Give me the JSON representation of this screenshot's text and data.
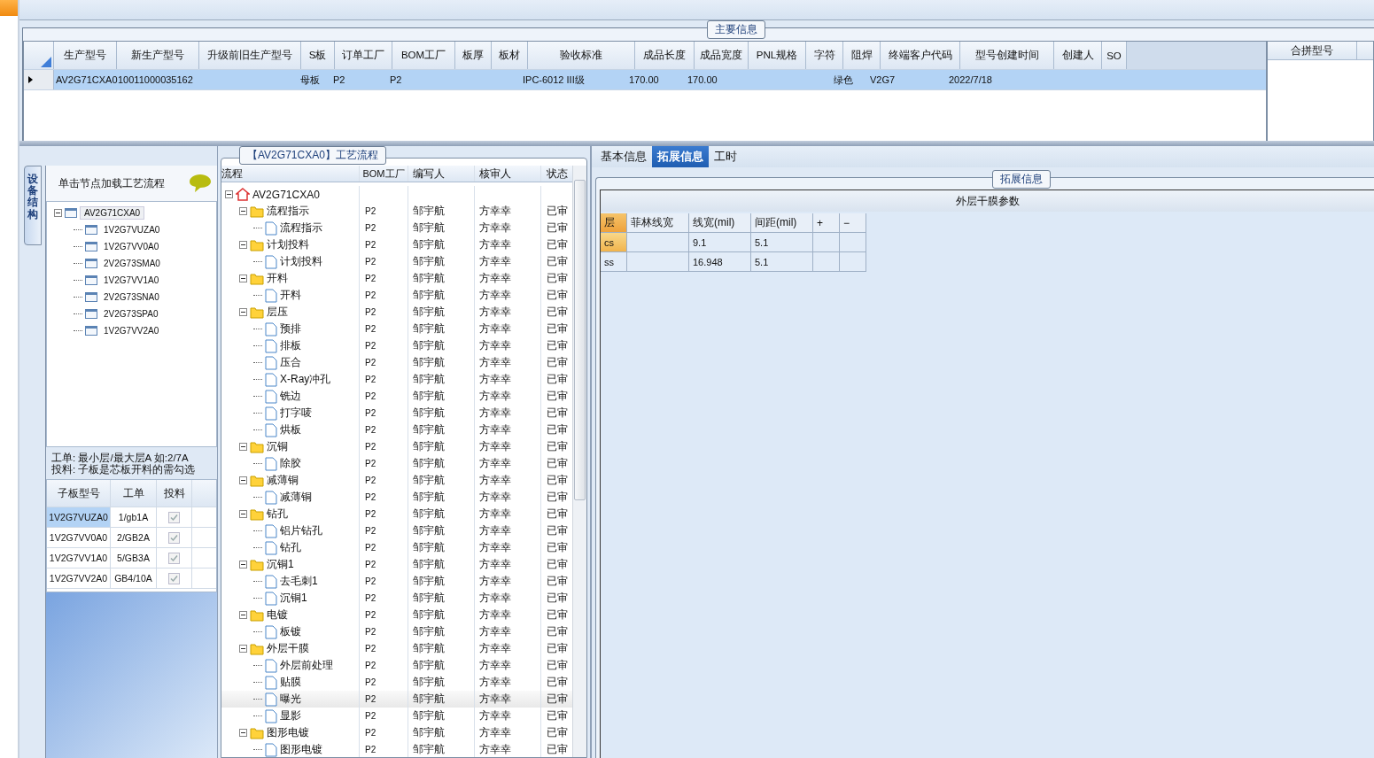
{
  "main_info": {
    "title": "主要信息",
    "grid": {
      "columns": [
        "生产型号",
        "新生产型号",
        "升级前旧生产型号",
        "S板",
        "订单工厂",
        "BOM工厂",
        "板厚",
        "板材",
        "验收标准",
        "成品长度",
        "成品宽度",
        "PNL规格",
        "字符",
        "阻焊",
        "终端客户代码",
        "型号创建时间",
        "创建人",
        "SO"
      ],
      "rows": [
        {
          "selected": true,
          "cells": [
            "AV2G71CXA0",
            "10011000035162",
            "",
            "母板",
            "P2",
            "P2",
            "",
            "",
            "IPC-6012 III级",
            "170.00",
            "170.00",
            "",
            "",
            "绿色",
            "V2G7",
            "2022/7/18",
            "",
            ""
          ]
        }
      ]
    },
    "merge_panel": {
      "heading": "合拼型号"
    }
  },
  "structure": {
    "side_tab": "设备结构",
    "header": "单击节点加载工艺流程",
    "tree": {
      "label": "AV2G71CXA0",
      "expanded": true,
      "selected": true,
      "children": [
        {
          "label": "1V2G7VUZA0",
          "selected": false
        },
        {
          "label": "1V2G7VV0A0",
          "selected": false
        },
        {
          "label": "2V2G73SMA0",
          "selected": false
        },
        {
          "label": "1V2G7VV1A0",
          "selected": false
        },
        {
          "label": "2V2G73SNA0",
          "selected": false
        },
        {
          "label": "2V2G73SPA0",
          "selected": false
        },
        {
          "label": "1V2G7VV2A0",
          "selected": false
        }
      ]
    },
    "notes": [
      "工单: 最小层/最大层A 如:2/7A",
      "投料: 子板是芯板开料的需勾选"
    ],
    "sub_table": {
      "columns": [
        "子板型号",
        "工单",
        "投料"
      ],
      "rows": [
        {
          "model": "1V2G7VUZA0",
          "order": "1/gb1A",
          "checked": true,
          "selected": true
        },
        {
          "model": "1V2G7VV0A0",
          "order": "2/GB2A",
          "checked": true,
          "selected": false
        },
        {
          "model": "1V2G7VV1A0",
          "order": "5/GB3A",
          "checked": true,
          "selected": false
        },
        {
          "model": "1V2G7VV2A0",
          "order": "GB4/10A",
          "checked": true,
          "selected": false
        }
      ]
    }
  },
  "process": {
    "title": "【AV2G71CXA0】工艺流程",
    "columns": [
      "流程",
      "BOM工厂",
      "编写人",
      "核审人",
      "状态"
    ],
    "root": {
      "label": "AV2G71CXA0",
      "expanded": true,
      "selected": false,
      "children": [
        {
          "label": "流程指示",
          "bom": "P2",
          "writer": "邹宇航",
          "reviewer": "方幸幸",
          "status": "已审",
          "expanded": true,
          "selected": false,
          "children": [
            {
              "label": "流程指示",
              "bom": "P2",
              "writer": "邹宇航",
              "reviewer": "方幸幸",
              "status": "已审",
              "selected": false
            }
          ]
        },
        {
          "label": "计划投料",
          "bom": "P2",
          "writer": "邹宇航",
          "reviewer": "方幸幸",
          "status": "已审",
          "expanded": true,
          "selected": false,
          "children": [
            {
              "label": "计划投料",
              "bom": "P2",
              "writer": "邹宇航",
              "reviewer": "方幸幸",
              "status": "已审",
              "selected": false
            }
          ]
        },
        {
          "label": "开料",
          "bom": "P2",
          "writer": "邹宇航",
          "reviewer": "方幸幸",
          "status": "已审",
          "expanded": true,
          "selected": false,
          "children": [
            {
              "label": "开料",
              "bom": "P2",
              "writer": "邹宇航",
              "reviewer": "方幸幸",
              "status": "已审",
              "selected": false
            }
          ]
        },
        {
          "label": "层压",
          "bom": "P2",
          "writer": "邹宇航",
          "reviewer": "方幸幸",
          "status": "已审",
          "expanded": true,
          "selected": false,
          "children": [
            {
              "label": "预排",
              "bom": "P2",
              "writer": "邹宇航",
              "reviewer": "方幸幸",
              "status": "已审",
              "selected": false
            },
            {
              "label": "排板",
              "bom": "P2",
              "writer": "邹宇航",
              "reviewer": "方幸幸",
              "status": "已审",
              "selected": false
            },
            {
              "label": "压合",
              "bom": "P2",
              "writer": "邹宇航",
              "reviewer": "方幸幸",
              "status": "已审",
              "selected": false
            },
            {
              "label": "X-Ray冲孔",
              "bom": "P2",
              "writer": "邹宇航",
              "reviewer": "方幸幸",
              "status": "已审",
              "selected": false
            },
            {
              "label": "铣边",
              "bom": "P2",
              "writer": "邹宇航",
              "reviewer": "方幸幸",
              "status": "已审",
              "selected": false
            },
            {
              "label": "打字唛",
              "bom": "P2",
              "writer": "邹宇航",
              "reviewer": "方幸幸",
              "status": "已审",
              "selected": false
            },
            {
              "label": "烘板",
              "bom": "P2",
              "writer": "邹宇航",
              "reviewer": "方幸幸",
              "status": "已审",
              "selected": false
            }
          ]
        },
        {
          "label": "沉铜",
          "bom": "P2",
          "writer": "邹宇航",
          "reviewer": "方幸幸",
          "status": "已审",
          "expanded": true,
          "selected": false,
          "children": [
            {
              "label": "除胶",
              "bom": "P2",
              "writer": "邹宇航",
              "reviewer": "方幸幸",
              "status": "已审",
              "selected": false
            }
          ]
        },
        {
          "label": "减薄铜",
          "bom": "P2",
          "writer": "邹宇航",
          "reviewer": "方幸幸",
          "status": "已审",
          "expanded": true,
          "selected": false,
          "children": [
            {
              "label": "减薄铜",
              "bom": "P2",
              "writer": "邹宇航",
              "reviewer": "方幸幸",
              "status": "已审",
              "selected": false
            }
          ]
        },
        {
          "label": "钻孔",
          "bom": "P2",
          "writer": "邹宇航",
          "reviewer": "方幸幸",
          "status": "已审",
          "expanded": true,
          "selected": false,
          "children": [
            {
              "label": "铝片钻孔",
              "bom": "P2",
              "writer": "邹宇航",
              "reviewer": "方幸幸",
              "status": "已审",
              "selected": false
            },
            {
              "label": "钻孔",
              "bom": "P2",
              "writer": "邹宇航",
              "reviewer": "方幸幸",
              "status": "已审",
              "selected": false
            }
          ]
        },
        {
          "label": "沉铜1",
          "bom": "P2",
          "writer": "邹宇航",
          "reviewer": "方幸幸",
          "status": "已审",
          "expanded": true,
          "selected": false,
          "children": [
            {
              "label": "去毛刺1",
              "bom": "P2",
              "writer": "邹宇航",
              "reviewer": "方幸幸",
              "status": "已审",
              "selected": false
            },
            {
              "label": "沉铜1",
              "bom": "P2",
              "writer": "邹宇航",
              "reviewer": "方幸幸",
              "status": "已审",
              "selected": false
            }
          ]
        },
        {
          "label": "电镀",
          "bom": "P2",
          "writer": "邹宇航",
          "reviewer": "方幸幸",
          "status": "已审",
          "expanded": true,
          "selected": false,
          "children": [
            {
              "label": "板镀",
              "bom": "P2",
              "writer": "邹宇航",
              "reviewer": "方幸幸",
              "status": "已审",
              "selected": false
            }
          ]
        },
        {
          "label": "外层干膜",
          "bom": "P2",
          "writer": "邹宇航",
          "reviewer": "方幸幸",
          "status": "已审",
          "expanded": true,
          "selected": false,
          "children": [
            {
              "label": "外层前处理",
              "bom": "P2",
              "writer": "邹宇航",
              "reviewer": "方幸幸",
              "status": "已审",
              "selected": false
            },
            {
              "label": "贴膜",
              "bom": "P2",
              "writer": "邹宇航",
              "reviewer": "方幸幸",
              "status": "已审",
              "selected": false
            },
            {
              "label": "曝光",
              "bom": "P2",
              "writer": "邹宇航",
              "reviewer": "方幸幸",
              "status": "已审",
              "selected": true
            },
            {
              "label": "显影",
              "bom": "P2",
              "writer": "邹宇航",
              "reviewer": "方幸幸",
              "status": "已审",
              "selected": false
            }
          ]
        },
        {
          "label": "图形电镀",
          "bom": "P2",
          "writer": "邹宇航",
          "reviewer": "方幸幸",
          "status": "已审",
          "expanded": true,
          "selected": false,
          "children": [
            {
              "label": "图形电镀",
              "bom": "P2",
              "writer": "邹宇航",
              "reviewer": "方幸幸",
              "status": "已审",
              "selected": false
            }
          ]
        }
      ]
    }
  },
  "details": {
    "tabs": [
      {
        "label": "基本信息",
        "selected": false
      },
      {
        "label": "拓展信息",
        "selected": true
      },
      {
        "label": "工时",
        "selected": false
      }
    ],
    "group_title": "拓展信息",
    "table_title": "外层干膜参数",
    "columns": [
      "层",
      "菲林线宽",
      "线宽(mil)",
      "间距(mil)",
      "+",
      "−"
    ],
    "rows": [
      {
        "selected": true,
        "cells": [
          "cs",
          "",
          "9.1",
          "5.1",
          "",
          ""
        ]
      },
      {
        "selected": false,
        "cells": [
          "ss",
          "",
          "16.948",
          "5.1",
          "",
          ""
        ]
      }
    ]
  }
}
